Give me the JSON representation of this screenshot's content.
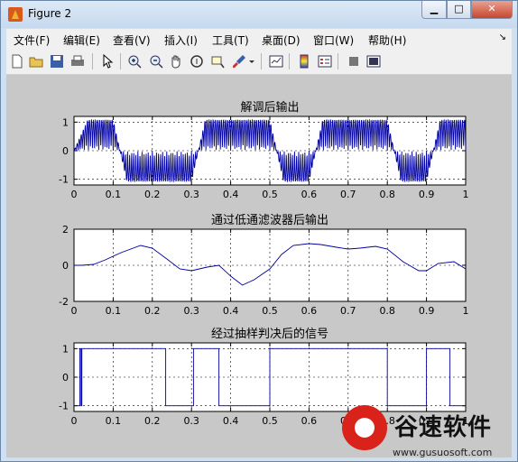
{
  "window": {
    "title": "Figure 2",
    "min_glyph": "▁",
    "max_glyph": "□",
    "close_glyph": "✕"
  },
  "menu": {
    "items": [
      "文件(F)",
      "编辑(E)",
      "查看(V)",
      "插入(I)",
      "工具(T)",
      "桌面(D)",
      "窗口(W)",
      "帮助(H)"
    ],
    "arrow": "↘"
  },
  "toolbar": {
    "icons": [
      "new-file-icon",
      "open-folder-icon",
      "save-icon",
      "print-icon",
      "pointer-icon",
      "zoom-in-icon",
      "zoom-out-icon",
      "pan-hand-icon",
      "rotate-3d-icon",
      "data-cursor-icon",
      "brush-icon",
      "brush-dropdown-icon",
      "link-plot-icon",
      "colorbar-icon",
      "legend-icon",
      "hide-plot-tools-icon",
      "show-plot-tools-icon"
    ]
  },
  "chart_data": [
    {
      "type": "line",
      "title": "解调后输出",
      "xlim": [
        0,
        1
      ],
      "ylim": [
        -1.2,
        1.2
      ],
      "xticks": [
        "0",
        "0.1",
        "0.2",
        "0.3",
        "0.4",
        "0.5",
        "0.6",
        "0.7",
        "0.8",
        "0.9",
        "1"
      ],
      "yticks": [
        "1",
        "0",
        "-1"
      ],
      "grid": true,
      "series": [
        {
          "color": "#0000a0",
          "bits": [
            1,
            0,
            0,
            1,
            1,
            0,
            1,
            1,
            0,
            1
          ]
        }
      ]
    },
    {
      "type": "line",
      "title": "通过低通滤波器后输出",
      "xlim": [
        0,
        1
      ],
      "ylim": [
        -2,
        2
      ],
      "xticks": [
        "0",
        "0.1",
        "0.2",
        "0.3",
        "0.4",
        "0.5",
        "0.6",
        "0.7",
        "0.8",
        "0.9",
        "1"
      ],
      "yticks": [
        "2",
        "0",
        "-2"
      ],
      "grid": true,
      "series": [
        {
          "color": "#0000a0",
          "x": [
            0,
            0.02,
            0.05,
            0.08,
            0.12,
            0.17,
            0.2,
            0.24,
            0.27,
            0.3,
            0.34,
            0.37,
            0.4,
            0.43,
            0.46,
            0.5,
            0.53,
            0.56,
            0.6,
            0.63,
            0.67,
            0.7,
            0.73,
            0.77,
            0.8,
            0.84,
            0.88,
            0.9,
            0.93,
            0.97,
            1
          ],
          "y": [
            0,
            0,
            0.05,
            0.3,
            0.7,
            1.1,
            0.95,
            0.3,
            -0.2,
            -0.3,
            -0.1,
            0,
            -0.6,
            -1.1,
            -0.8,
            -0.2,
            0.6,
            1.1,
            1.2,
            1.15,
            1.0,
            0.9,
            0.95,
            1.05,
            0.9,
            0.2,
            -0.3,
            -0.3,
            0.1,
            0.2,
            -0.2
          ]
        }
      ]
    },
    {
      "type": "line",
      "title": "经过抽样判决后的信号",
      "xlim": [
        0,
        1
      ],
      "ylim": [
        -1.2,
        1.2
      ],
      "xticks": [
        "0",
        "0.1",
        "0.2",
        "0.3",
        "0.4",
        "0.5",
        "0.6",
        "0.7",
        "0.8",
        "0.9",
        "1"
      ],
      "yticks": [
        "1",
        "0",
        "-1"
      ],
      "grid": true,
      "series": [
        {
          "color": "#0000a0",
          "x": [
            0,
            0.015,
            0.015,
            0.018,
            0.018,
            0.02,
            0.02,
            0.023,
            0.023,
            0.234,
            0.234,
            0.305,
            0.305,
            0.31,
            0.31,
            0.37,
            0.37,
            0.5,
            0.5,
            0.8,
            0.8,
            0.83,
            0.83,
            0.83,
            0.83,
            0.9,
            0.9,
            0.96,
            0.96,
            1
          ],
          "y": [
            -1,
            -1,
            1,
            1,
            -1,
            -1,
            1,
            1,
            1,
            1,
            -1,
            -1,
            1,
            1,
            1,
            1,
            -1,
            -1,
            1,
            1,
            -1,
            -1,
            -1,
            -1,
            -1,
            -1,
            1,
            1,
            -1,
            -1
          ]
        }
      ]
    }
  ],
  "watermark": {
    "main": "谷速软件",
    "url": "www.gusuosoft.com"
  }
}
